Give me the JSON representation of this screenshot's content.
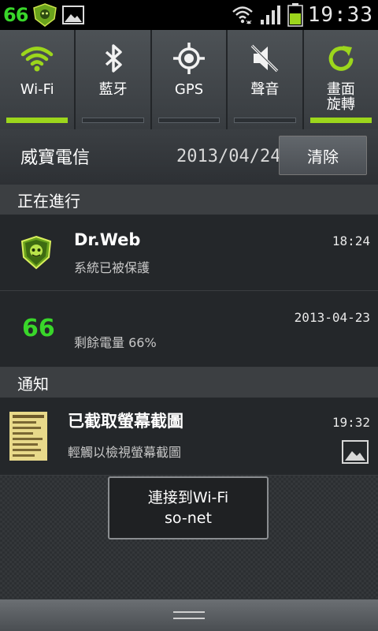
{
  "status_bar": {
    "battery_badge": "66",
    "time": "19:33",
    "icons": [
      "battery-percent-icon",
      "dr-web-shield-icon",
      "screenshot-image-icon",
      "wifi-signal-icon",
      "cell-signal-icon",
      "battery-icon"
    ]
  },
  "quick_toggles": [
    {
      "label": "Wi-Fi",
      "icon": "wifi-icon",
      "on": true
    },
    {
      "label": "藍牙",
      "icon": "bluetooth-icon",
      "on": false
    },
    {
      "label": "GPS",
      "icon": "gps-icon",
      "on": false
    },
    {
      "label": "聲音",
      "icon": "mute-icon",
      "on": false
    },
    {
      "label": "畫面\n旋轉",
      "icon": "rotate-icon",
      "on": true
    }
  ],
  "carrier": {
    "name": "威寶電信",
    "date": "2013/04/24",
    "clear_label": "清除"
  },
  "ongoing": {
    "header": "正在進行",
    "items": [
      {
        "title": "Dr.Web",
        "text": "系統已被保護",
        "time": "18:24",
        "icon": "dr-web-shield-icon"
      },
      {
        "title": "",
        "icon_text": "66",
        "text": "剩餘電量 66%",
        "time": "2013-04-23",
        "icon": "battery-percent-icon"
      }
    ]
  },
  "notifications": {
    "header": "通知",
    "items": [
      {
        "title": "已截取螢幕截圖",
        "text": "輕觸以檢視螢幕截圖",
        "time": "19:32",
        "icon": "screenshot-thumbnail-icon",
        "badge_icon": "image-icon"
      }
    ]
  },
  "toast": {
    "line1": "連接到Wi-Fi",
    "line2": "so-net"
  },
  "colors": {
    "accent": "#9cd61c",
    "battery_green": "#39d62a"
  }
}
